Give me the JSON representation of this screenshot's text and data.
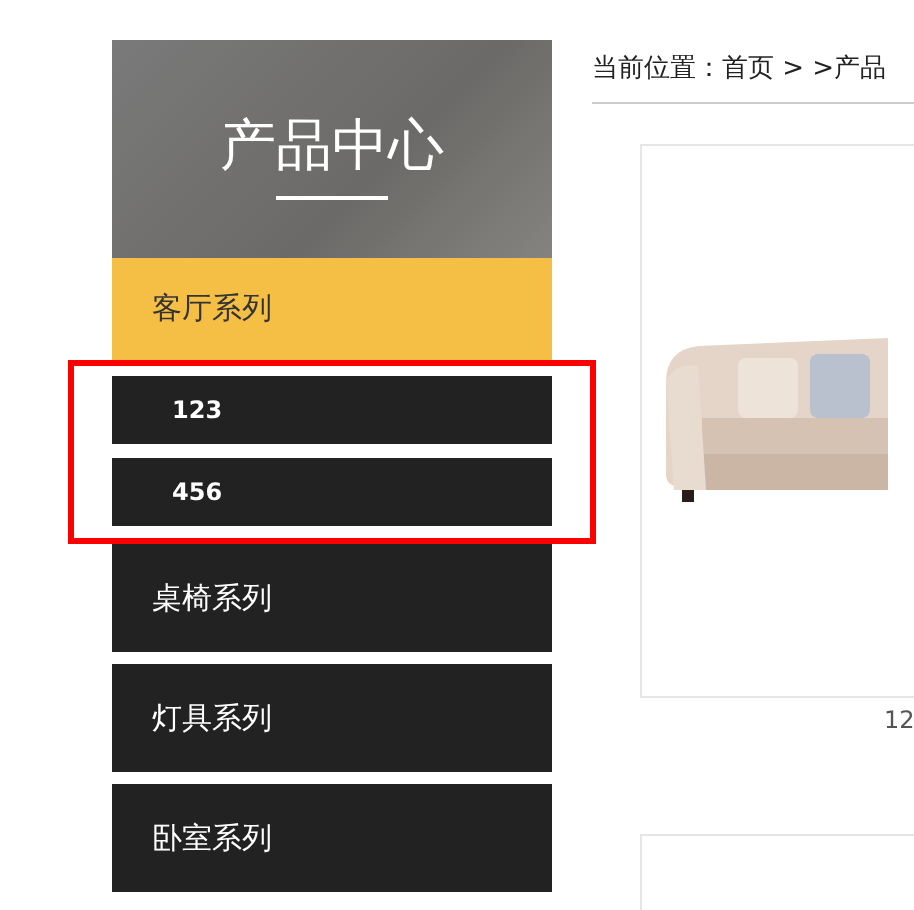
{
  "sidebar": {
    "title": "产品中心",
    "categories": [
      {
        "label": "客厅系列",
        "selected": true,
        "children_highlighted": true,
        "children": [
          {
            "label": "123"
          },
          {
            "label": "456"
          }
        ]
      },
      {
        "label": "桌椅系列",
        "selected": false
      },
      {
        "label": "灯具系列",
        "selected": false
      },
      {
        "label": "卧室系列",
        "selected": false
      }
    ]
  },
  "breadcrumb": "当前位置：首页 > >产品",
  "products": [
    {
      "caption": "12"
    }
  ]
}
